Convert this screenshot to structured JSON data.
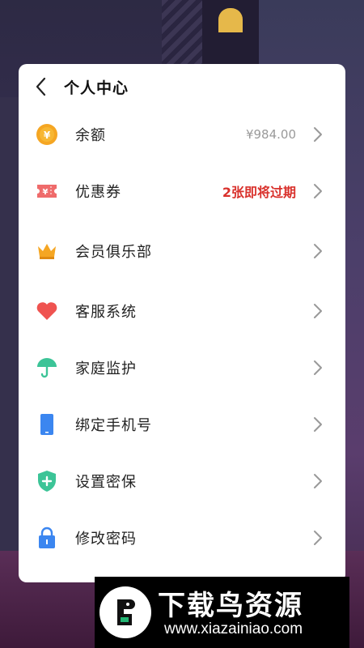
{
  "header": {
    "title": "个人中心"
  },
  "menu": [
    {
      "label": "余额",
      "value": "¥984.00",
      "icon": "coin-icon",
      "color": "#f5a623"
    },
    {
      "label": "优惠券",
      "value": "2张即将过期",
      "icon": "ticket-icon",
      "color": "#ef6b6b"
    },
    {
      "label": "会员俱乐部",
      "value": "",
      "icon": "crown-icon",
      "color": "#f5a623"
    },
    {
      "label": "客服系统",
      "value": "",
      "icon": "heart-icon",
      "color": "#ef5350"
    },
    {
      "label": "家庭监护",
      "value": "",
      "icon": "umbrella-icon",
      "color": "#3cc497"
    },
    {
      "label": "绑定手机号",
      "value": "",
      "icon": "phone-icon",
      "color": "#3b86f0"
    },
    {
      "label": "设置密保",
      "value": "",
      "icon": "shield-icon",
      "color": "#3cc497"
    },
    {
      "label": "修改密码",
      "value": "",
      "icon": "lock-icon",
      "color": "#3b86f0"
    }
  ],
  "watermark": {
    "name": "下载鸟资源",
    "url": "www.xiazainiao.com"
  }
}
